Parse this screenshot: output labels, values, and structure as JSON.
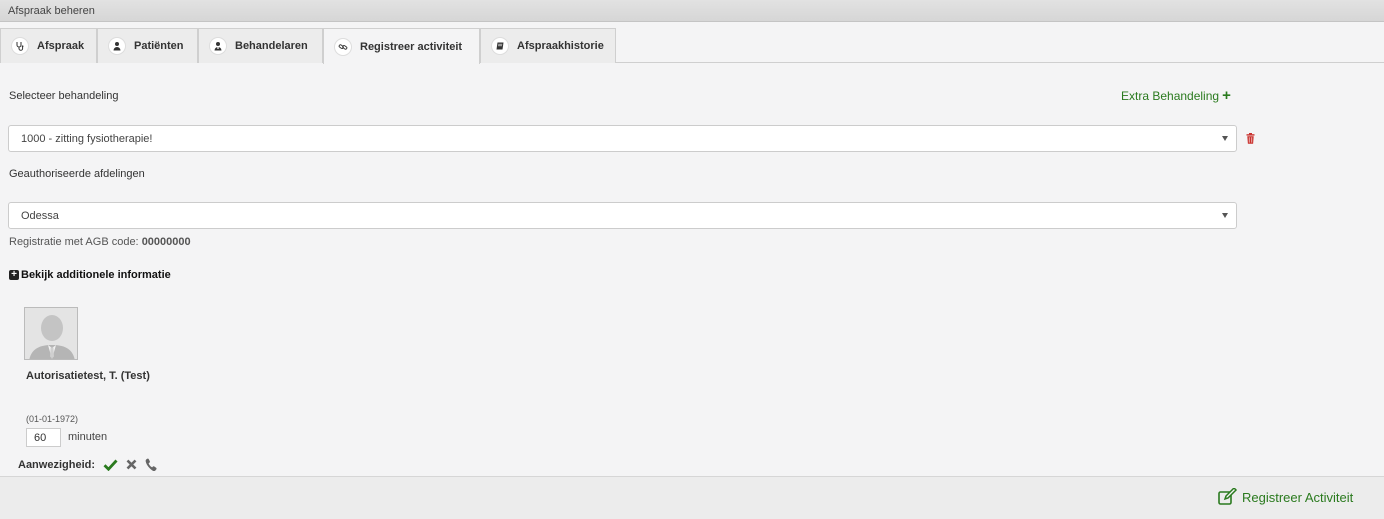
{
  "window": {
    "title": "Afspraak beheren"
  },
  "tabs": [
    {
      "label": "Afspraak",
      "icon": "stethoscope-icon"
    },
    {
      "label": "Patiënten",
      "icon": "user-icon"
    },
    {
      "label": "Behandelaren",
      "icon": "user-doctor-icon"
    },
    {
      "label": "Registreer activiteit",
      "icon": "link-icon",
      "active": true
    },
    {
      "label": "Afspraakhistorie",
      "icon": "book-icon"
    }
  ],
  "form": {
    "treatment_label": "Selecteer behandeling",
    "extra_treatment_label": "Extra Behandeling",
    "treatment_value": "1000 - zitting fysiotherapie!",
    "department_label": "Geauthoriseerde afdelingen",
    "department_value": "Odessa",
    "agb_prefix": "Registratie met AGB code:",
    "agb_code": "00000000",
    "additional_info_label": "Bekijk additionele informatie"
  },
  "patient": {
    "name": "Autorisatietest, T. (Test)",
    "dob": "(01-01-1972)",
    "minutes_value": "60",
    "minutes_label": "minuten",
    "presence_label": "Aanwezigheid:"
  },
  "footer": {
    "register_label": "Registreer Activiteit"
  },
  "colors": {
    "accent_green": "#2a7a1e",
    "danger_red": "#c9302c"
  }
}
